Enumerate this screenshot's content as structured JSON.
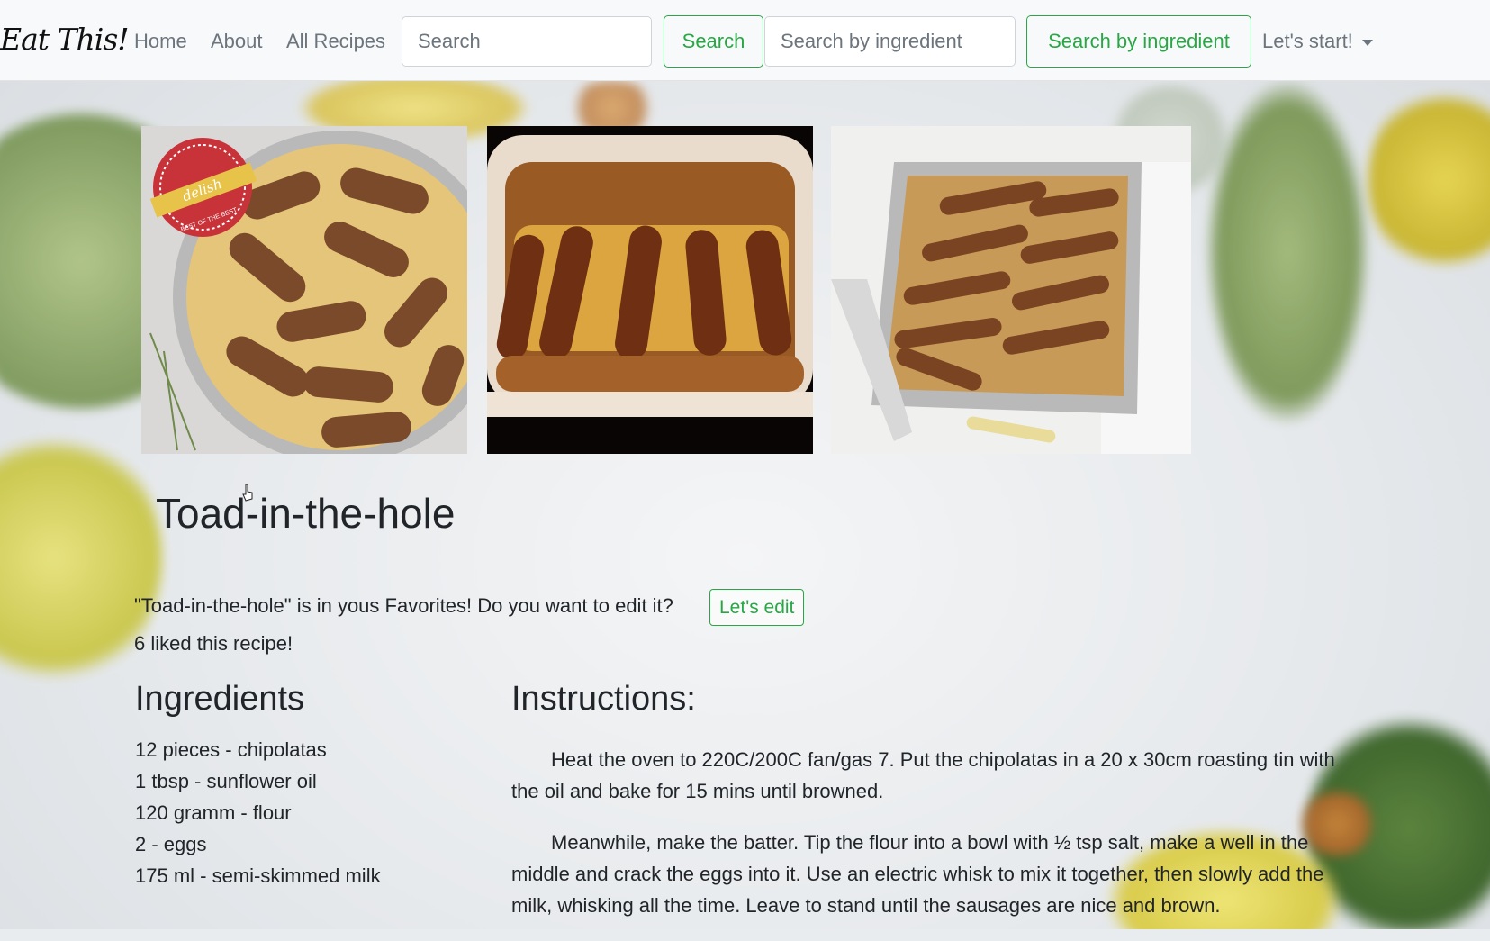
{
  "brand": "Eat This!",
  "nav": {
    "home": "Home",
    "about": "About",
    "all_recipes": "All Recipes",
    "search_placeholder": "Search",
    "search_button": "Search",
    "ingredient_placeholder": "Search by ingredient",
    "ingredient_button": "Search by ingredient",
    "dropdown": "Let's start!"
  },
  "gallery": {
    "badge_text": "delish",
    "badge_subtext": "BEST OF THE BEST"
  },
  "recipe": {
    "title": "Toad-in-the-hole",
    "favorite_text": "\"Toad-in-the-hole\" is in yous Favorites! Do you want to edit it?",
    "edit_button": "Let's edit",
    "likes_text": "6 liked this recipe!",
    "ingredients_heading": "Ingredients",
    "ingredients": [
      "12 pieces - chipolatas",
      "1 tbsp - sunflower oil",
      "120 gramm - flour",
      "2 - eggs",
      "175 ml - semi-skimmed milk"
    ],
    "instructions_heading": "Instructions:",
    "instructions": [
      "Heat the oven to 220C/200C fan/gas 7. Put the chipolatas in a 20 x 30cm roasting tin with the oil and bake for 15 mins until browned.",
      "Meanwhile, make the batter. Tip the flour into a bowl with ½ tsp salt, make a well in the middle and crack the eggs into it. Use an electric whisk to mix it together, then slowly add the milk, whisking all the time. Leave to stand until the sausages are nice and brown."
    ]
  },
  "colors": {
    "accent": "#28a745",
    "navbar_bg": "#f8f9fa",
    "nav_text": "#6c757d"
  }
}
